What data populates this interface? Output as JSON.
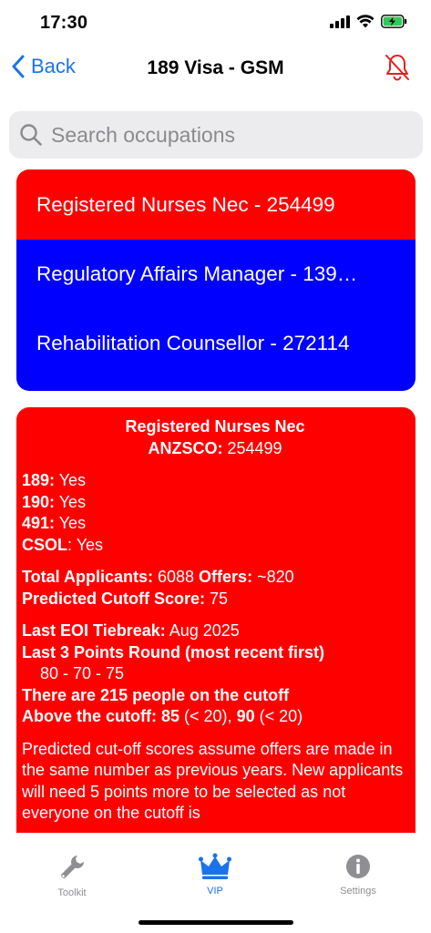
{
  "status": {
    "time": "17:30"
  },
  "nav": {
    "back_label": "Back",
    "title": "189 Visa - GSM"
  },
  "search": {
    "placeholder": "Search occupations"
  },
  "occupations": [
    {
      "label": "Registered Nurses Nec - 254499",
      "color": "#ff0000",
      "selected": true
    },
    {
      "label": "Regulatory Affairs Manager - 139…",
      "color": "#0000ff",
      "selected": false
    },
    {
      "label": "Rehabilitation Counsellor - 272114",
      "color": "#0000ff",
      "selected": false
    }
  ],
  "detail": {
    "name": "Registered Nurses Nec",
    "anzsco_label": "ANZSCO:",
    "anzsco_value": " 254499",
    "visas": [
      {
        "label": "189:",
        "value": " Yes"
      },
      {
        "label": "190:",
        "value": " Yes"
      },
      {
        "label": "491:",
        "value": " Yes"
      },
      {
        "label": "CSOL",
        "value": ": Yes"
      }
    ],
    "total_applicants_label": "Total Applicants:",
    "total_applicants_value": " 6088 ",
    "offers_label": "Offers:",
    "offers_value": " ~820",
    "predicted_label": "Predicted Cutoff Score:",
    "predicted_value": " 75",
    "tiebreak_label": "Last EOI Tiebreak:",
    "tiebreak_value": " Aug 2025",
    "last_rounds_label": "Last 3 Points Round (most recent first)",
    "last_rounds_value": "80 - 70 - 75",
    "people_on_cutoff": "There are 215 people on the cutoff",
    "above_label": "Above the cutoff:",
    "above_85": " 85",
    "above_85_count": " (< 20), ",
    "above_90": "90",
    "above_90_count": " (< 20)",
    "note": "Predicted cut-off scores assume offers are made in the same number as previous years. New applicants will need 5 points more to be selected as not everyone on the cutoff is"
  },
  "tabs": [
    {
      "label": "Toolkit",
      "icon": "wrench-icon",
      "active": false
    },
    {
      "label": "VIP",
      "icon": "crown-icon",
      "active": true
    },
    {
      "label": "Settings",
      "icon": "info-icon",
      "active": false
    }
  ],
  "colors": {
    "accent": "#1a73e8",
    "selected_bg": "#ff0000",
    "unselected_bg": "#0000ff",
    "bell_red": "#e0201c"
  }
}
